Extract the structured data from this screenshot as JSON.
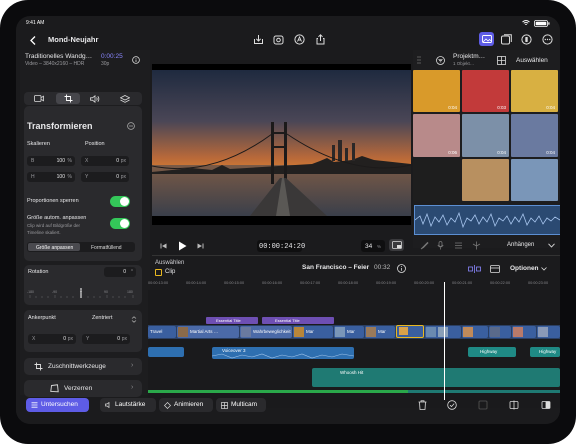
{
  "status": {
    "time": "9:41 AM"
  },
  "header": {
    "project_title": "Mond-Neujahr",
    "clip_title": "Traditionelles Wandg…",
    "clip_duration": "0:00:25",
    "clip_info": "Video – 3840x2160 – HDR",
    "clip_fps": "30p"
  },
  "inspector": {
    "section_title": "Transformieren",
    "scale_label": "Skalieren",
    "scale_x_axis": "B",
    "scale_x": "100",
    "scale_y_axis": "H",
    "scale_y": "100",
    "percent": "%",
    "position_label": "Position",
    "pos_x_axis": "X",
    "pos_x": "0",
    "pos_y_axis": "Y",
    "pos_y": "0",
    "unit_px": "px",
    "proportional_label": "Proportionen sperren",
    "autosize_title": "Größe autom. anpassen",
    "autosize_desc_1": "Clip wird auf Bildgröße der",
    "autosize_desc_2": "Timeline skaliert.",
    "fit_option": "Größe anpassen",
    "fill_option": "Formatfüllend",
    "rotation_label": "Rotation",
    "rotation_value": "0",
    "degree": "°",
    "dial_ticks": [
      "-180",
      "-90",
      "0",
      "90",
      "180"
    ],
    "anchor_label": "Ankerpunkt",
    "anchor_value": "Zentriert",
    "anchor_x_axis": "X",
    "anchor_x": "0",
    "anchor_y_axis": "Y",
    "anchor_y": "0",
    "crop_tools": "Zuschnittwerkzeuge",
    "distort": "Verzerren"
  },
  "browser": {
    "title": "Projektm…",
    "subtitle": "1 Objekt…",
    "select_label": "Auswählen",
    "thumb_durations": [
      "0:04",
      "0:03",
      "0:04",
      "0:06",
      "0:04",
      "0:04"
    ],
    "thumb_colors": [
      "#d99a2a",
      "#c23a3a",
      "#d8b042",
      "#b88a8a",
      "#7c90a8",
      "#6a7aa0",
      "#1e1e1e",
      "#b89060",
      "#7a96b8"
    ],
    "connect_label": "Anhängen"
  },
  "transport": {
    "timecode": "00:00:24:20",
    "zoom": "34",
    "zoom_unit": "%"
  },
  "timeline": {
    "select_label": "Auswählen",
    "clip_label": "Clip",
    "project_name": "San Francisco – Feier",
    "project_duration": "00:32",
    "options_label": "Optionen",
    "ruler": [
      "00:00:13:00",
      "00:00:14:00",
      "00:00:15:00",
      "00:00:16:00",
      "00:00:17:00",
      "00:00:18:00",
      "00:00:19:00",
      "00:00:20:00",
      "00:00:21:00",
      "00:00:22:00",
      "00:00:23:00"
    ],
    "titles": [
      "Essential Title",
      "Essential Title"
    ],
    "clips": [
      "Travel",
      "Martial Arts …",
      "Wahrbeweglichkeit",
      "Mar",
      "Mar",
      "Mar"
    ],
    "audio_clips": [
      "Voiceover 3",
      "Highway",
      "Highway"
    ],
    "music_clip": "Whoosh Hit"
  },
  "bottom": {
    "inspect": "Untersuchen",
    "volume": "Lautstärke",
    "animate": "Animieren",
    "multicam": "Multicam"
  },
  "colors": {
    "accent": "#5e5ce6",
    "toggle_on": "#34c759",
    "clip_blue": "#3a5f9f",
    "title_purple": "#6e4fb3",
    "audio_blue": "#2e6fb0",
    "music_teal": "#1f7a73",
    "selected_yellow": "#e8b820"
  }
}
